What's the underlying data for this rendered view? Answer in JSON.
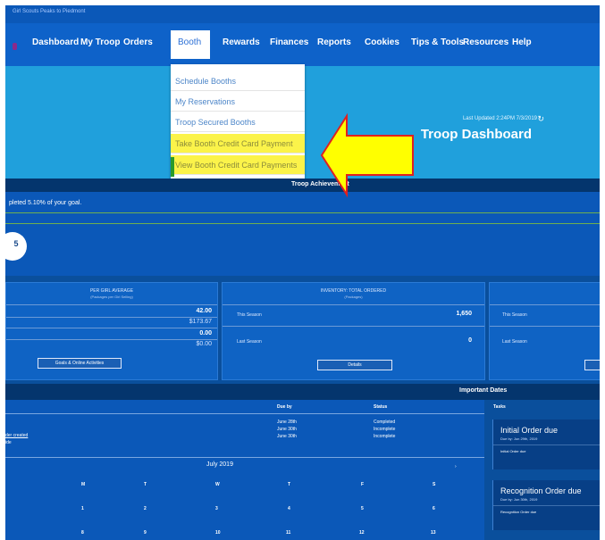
{
  "topbar": {
    "tiny_text": "Girl Scouts Peaks to Piedmont"
  },
  "nav": {
    "dashboard": "Dashboard",
    "my_troop": "My Troop",
    "orders": "Orders",
    "booth": "Booth",
    "rewards": "Rewards",
    "finances": "Finances",
    "reports": "Reports",
    "cookies": "Cookies",
    "tips_tools": "Tips & Tools",
    "resources": "Resources",
    "help": "Help"
  },
  "booth_menu": {
    "items": [
      "Schedule Booths",
      "My Reservations",
      "Troop Secured Booths",
      "Take Booth Credit Card Payment",
      "View Booth Credit Card Payments"
    ],
    "highlight_color": "#fbf34a"
  },
  "banner": {
    "last_updated": "Last Updated 2:24PM 7/3/2019",
    "refresh_icon": "refresh-icon",
    "title": "Troop Dashboard"
  },
  "achievement": {
    "bar_title": "Troop Achievement",
    "goal_text": "pleted 5.10% of your goal.",
    "badge": "5"
  },
  "cards": {
    "card1": {
      "header": "PER GIRL AVERAGE",
      "sub": "(Packages per Girl Selling)",
      "val1": "42.00",
      "val2": "$173.67",
      "val3": "0.00",
      "val4": "$0.00",
      "button": "Goals & Online Activities"
    },
    "card2": {
      "header": "INVENTORY: TOTAL ORDERED",
      "sub": "(Packages)",
      "this_season_label": "This Season",
      "this_season_val": "1,650",
      "last_season_label": "Last Season",
      "last_season_val": "0",
      "button": "Details"
    },
    "card3": {
      "this_season_label": "This Season",
      "last_season_label": "Last Season"
    }
  },
  "important_dates": {
    "bar_title": "Important Dates",
    "headers": {
      "due_by": "Due by",
      "status": "Status",
      "tasks": "Tasks"
    },
    "rows": [
      {
        "due": "June 28th",
        "status": "Completed"
      },
      {
        "due": "June 30th",
        "status": "Incomplete"
      },
      {
        "due": "June 30th",
        "status": "Incomplete"
      }
    ],
    "link_text": "der created",
    "extra_text": "ide",
    "calendar": {
      "month": "July 2019",
      "weekdays": [
        "M",
        "T",
        "W",
        "T",
        "F",
        "S"
      ],
      "row1": [
        "1",
        "2",
        "3",
        "4",
        "5",
        "6"
      ],
      "row2": [
        "8",
        "9",
        "10",
        "11",
        "12",
        "13"
      ]
    }
  },
  "tasks": [
    {
      "title": "Initial Order due",
      "due": "Due by: Jun 29th, 2019",
      "desc": "Initial Order due"
    },
    {
      "title": "Recognition Order due",
      "due": "Due by: Jun 30th, 2019",
      "desc": "Recognition Order due"
    }
  ],
  "annotation": {
    "arrow_color": "#ffff00",
    "arrow_outline": "#e02020"
  }
}
